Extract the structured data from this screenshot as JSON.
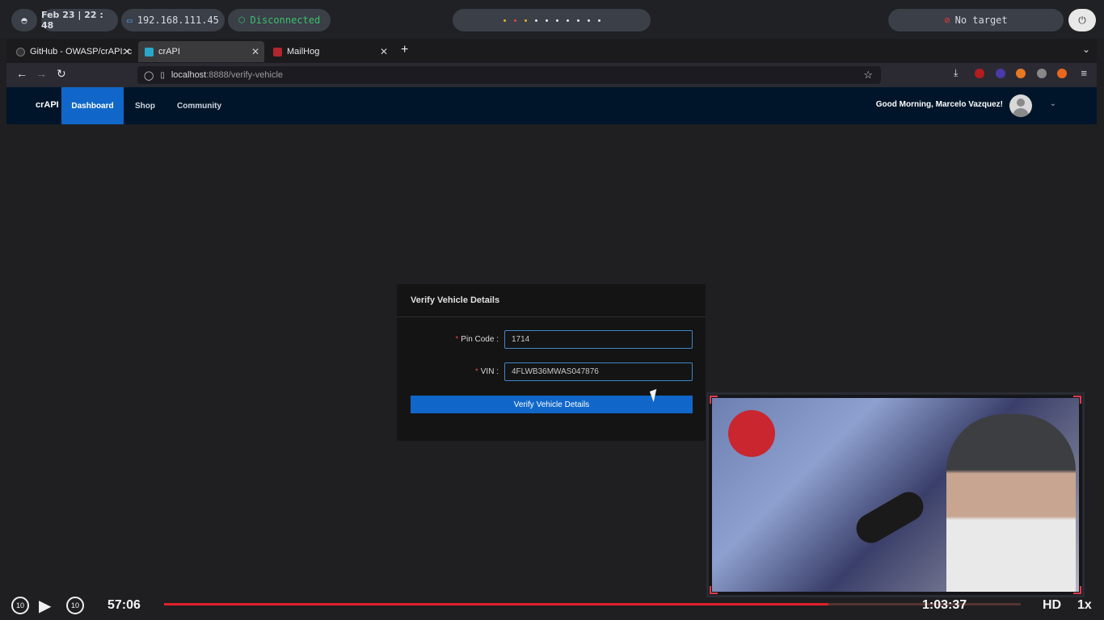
{
  "topbar": {
    "date": "Feb 23 | 22 : 48",
    "ip": "192.168.111.45",
    "vpn_status": "Disconnected",
    "target": "No target",
    "workspaces": [
      false,
      true,
      true,
      false,
      false,
      false,
      false,
      false,
      false,
      false
    ]
  },
  "browser": {
    "tabs": [
      {
        "label": "GitHub - OWASP/crAPI: c",
        "icon": "github-icon",
        "active": false
      },
      {
        "label": "crAPI",
        "icon": "crapi-icon",
        "active": true
      },
      {
        "label": "MailHog",
        "icon": "mailhog-icon",
        "active": false
      }
    ],
    "url_host": "localhost",
    "url_path": ":8888/verify-vehicle"
  },
  "app": {
    "brand": "crAPI",
    "menu": [
      "Dashboard",
      "Shop",
      "Community"
    ],
    "greeting": "Good Morning, Marcelo Vazquez!"
  },
  "form": {
    "title": "Verify Vehicle Details",
    "pin_label": "Pin Code",
    "pin_value": "1714",
    "vin_label": "VIN",
    "vin_value": "4FLWB36MWAS047876",
    "submit_label": "Verify Vehicle Details"
  },
  "video": {
    "current_time": "57:06",
    "remaining_time": "1:03:37",
    "progress": 0.775,
    "quality": "HD",
    "speed": "1x",
    "skip_seconds": "10"
  }
}
